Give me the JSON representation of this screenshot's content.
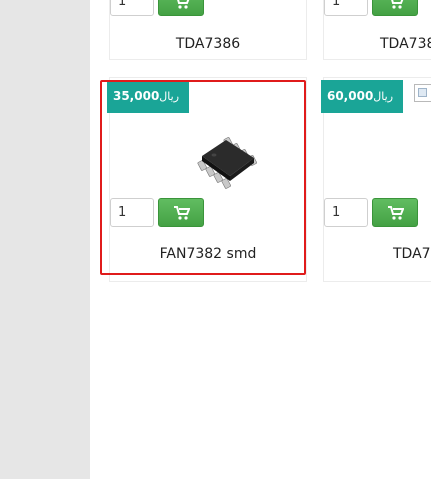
{
  "products": [
    {
      "name": "TDA7386",
      "quantity": "1"
    },
    {
      "name": "TDA738",
      "quantity": "1"
    },
    {
      "name": "FAN7382 smd",
      "quantity": "1",
      "price": "35,000",
      "currency": "ریال",
      "image": "soic8-chip-image"
    },
    {
      "name": "TDA7",
      "quantity": "1",
      "price": "60,000",
      "currency": "ریال",
      "image": "broken-image-icon"
    }
  ],
  "colors": {
    "badge": "#1aa597",
    "cart_button": "#4cae4c",
    "highlight": "#e01b1b",
    "sidebar": "#e6e6e6"
  },
  "icons": {
    "cart": "shopping-cart-icon"
  }
}
